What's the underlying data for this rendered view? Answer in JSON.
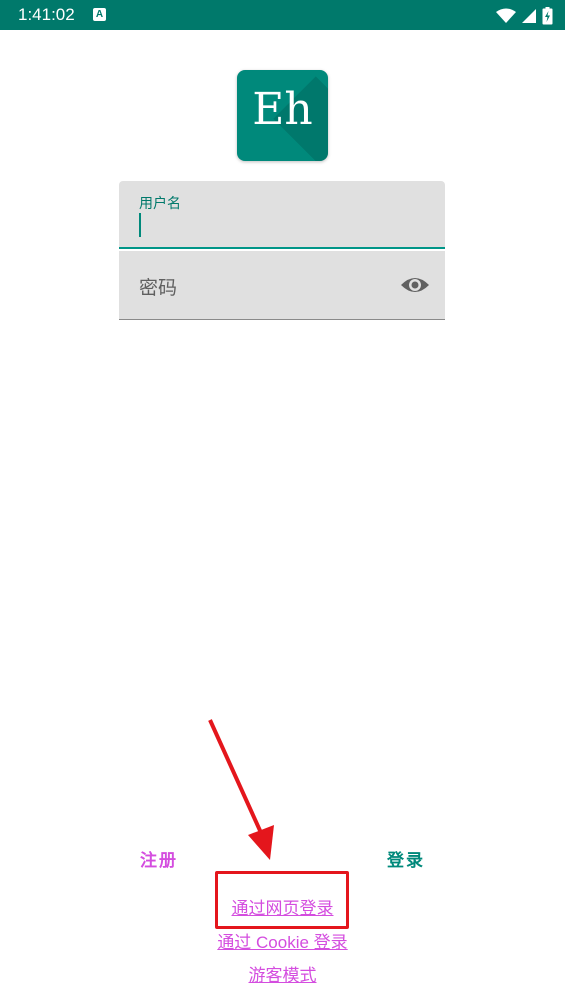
{
  "status_bar": {
    "time": "1:41:02",
    "notification_icon_letter": "A",
    "icons": [
      "wifi-icon",
      "signal-icon",
      "battery-charging-icon"
    ],
    "color": "#00796b"
  },
  "logo": {
    "text": "Eh",
    "color": "#00897b"
  },
  "login_form": {
    "username_label": "用户名",
    "username_value": "",
    "password_label": "密码",
    "password_toggle_icon": "eye-icon",
    "accent": "#009688"
  },
  "actions": {
    "register_label": "注册",
    "login_label": "登录",
    "register_color": "#d44ddf",
    "login_color": "#00897b"
  },
  "links": {
    "web_login": "通过网页登录",
    "cookie_login": "通过 Cookie 登录",
    "guest_mode": "游客模式"
  },
  "annotation": {
    "arrow_color": "#e4161c",
    "box_color": "#e4161c"
  }
}
